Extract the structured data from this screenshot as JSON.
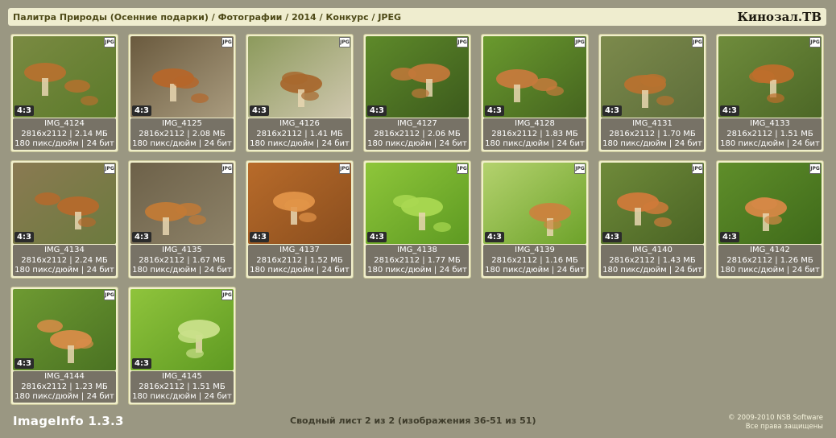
{
  "header": {
    "breadcrumb": [
      "Палитра Природы (Осенние подарки)",
      "Фотографии",
      "2014",
      "Конкурс",
      "JPEG"
    ],
    "separator": "/",
    "site_title": "Кинозал.ТВ"
  },
  "thumbnails": [
    {
      "name": "IMG_4124",
      "dims": "2816x2112 | 2.14 МБ",
      "meta": "180 пикс/дюйм | 24 бит",
      "ratio": "4:3",
      "type_badge": "JPG",
      "palette": [
        "#7a8a42",
        "#5b7a2a",
        "#b5712e"
      ]
    },
    {
      "name": "IMG_4125",
      "dims": "2816x2112 | 2.08 МБ",
      "meta": "180 пикс/дюйм | 24 бит",
      "ratio": "4:3",
      "type_badge": "JPG",
      "palette": [
        "#6a5a3e",
        "#a99b7e",
        "#b5662a"
      ]
    },
    {
      "name": "IMG_4126",
      "dims": "2816x2112 | 1.41 МБ",
      "meta": "180 пикс/дюйм | 24 бит",
      "ratio": "4:3",
      "type_badge": "JPG",
      "palette": [
        "#8c9a5c",
        "#cfc7ae",
        "#a8682e"
      ]
    },
    {
      "name": "IMG_4127",
      "dims": "2816x2112 | 2.06 МБ",
      "meta": "180 пикс/дюйм | 24 бит",
      "ratio": "4:3",
      "type_badge": "JPG",
      "palette": [
        "#5e8a2a",
        "#3c5a1c",
        "#c2783a"
      ]
    },
    {
      "name": "IMG_4128",
      "dims": "2816x2112 | 1.83 МБ",
      "meta": "180 пикс/дюйм | 24 бит",
      "ratio": "4:3",
      "type_badge": "JPG",
      "palette": [
        "#6a9a2e",
        "#45641f",
        "#c67a3c"
      ]
    },
    {
      "name": "IMG_4131",
      "dims": "2816x2112 | 1.70 МБ",
      "meta": "180 пикс/дюйм | 24 бит",
      "ratio": "4:3",
      "type_badge": "JPG",
      "palette": [
        "#7c8a4c",
        "#5e6e3a",
        "#b7722f"
      ]
    },
    {
      "name": "IMG_4133",
      "dims": "2816x2112 | 1.51 МБ",
      "meta": "180 пикс/дюйм | 24 бит",
      "ratio": "4:3",
      "type_badge": "JPG",
      "palette": [
        "#6f8c3c",
        "#4c6726",
        "#bd6e2b"
      ]
    },
    {
      "name": "IMG_4134",
      "dims": "2816x2112 | 2.24 МБ",
      "meta": "180 пикс/дюйм | 24 бит",
      "ratio": "4:3",
      "type_badge": "JPG",
      "palette": [
        "#8a7a52",
        "#6c7a3e",
        "#b56a2c"
      ]
    },
    {
      "name": "IMG_4135",
      "dims": "2816x2112 | 1.67 МБ",
      "meta": "180 пикс/дюйм | 24 бит",
      "ratio": "4:3",
      "type_badge": "JPG",
      "palette": [
        "#6d6149",
        "#8d8268",
        "#c27a36"
      ]
    },
    {
      "name": "IMG_4137",
      "dims": "2816x2112 | 1.52 МБ",
      "meta": "180 пикс/дюйм | 24 бит",
      "ratio": "4:3",
      "type_badge": "JPG",
      "palette": [
        "#b86b2a",
        "#8a4e1e",
        "#e29448"
      ]
    },
    {
      "name": "IMG_4138",
      "dims": "2816x2112 | 1.77 МБ",
      "meta": "180 пикс/дюйм | 24 бит",
      "ratio": "4:3",
      "type_badge": "JPG",
      "palette": [
        "#8ec63a",
        "#5e9a22",
        "#a9d851"
      ]
    },
    {
      "name": "IMG_4139",
      "dims": "2816x2112 | 1.16 МБ",
      "meta": "180 пикс/дюйм | 24 бит",
      "ratio": "4:3",
      "type_badge": "JPG",
      "palette": [
        "#b4d26e",
        "#6da22a",
        "#c9843e"
      ]
    },
    {
      "name": "IMG_4140",
      "dims": "2816x2112 | 1.43 МБ",
      "meta": "180 пикс/дюйм | 24 бит",
      "ratio": "4:3",
      "type_badge": "JPG",
      "palette": [
        "#6f8a3a",
        "#4a6424",
        "#cf7a3a"
      ]
    },
    {
      "name": "IMG_4142",
      "dims": "2816x2112 | 1.26 МБ",
      "meta": "180 пикс/дюйм | 24 бит",
      "ratio": "4:3",
      "type_badge": "JPG",
      "palette": [
        "#5f8e2a",
        "#3f6a1a",
        "#d68846"
      ]
    },
    {
      "name": "IMG_4144",
      "dims": "2816x2112 | 1.23 МБ",
      "meta": "180 пикс/дюйм | 24 бит",
      "ratio": "4:3",
      "type_badge": "JPG",
      "palette": [
        "#6e9a32",
        "#4a7222",
        "#d88c48"
      ]
    },
    {
      "name": "IMG_4145",
      "dims": "2816x2112 | 1.51 МБ",
      "meta": "180 пикс/дюйм | 24 бит",
      "ratio": "4:3",
      "type_badge": "JPG",
      "palette": [
        "#8fc43c",
        "#5f9a22",
        "#c9e08a"
      ]
    }
  ],
  "footer": {
    "logo": "ImageInfo 1.3.3",
    "status": "Сводный лист 2 из 2 (изображения 36-51 из 51)",
    "copyright_line1": "© 2009-2010 NSB Software",
    "copyright_line2": "Все права защищены"
  },
  "colors": {
    "background": "#9a9782",
    "header_bg": "#efedcf",
    "card_bg": "#f1efcb",
    "info_bg": "#777266"
  }
}
